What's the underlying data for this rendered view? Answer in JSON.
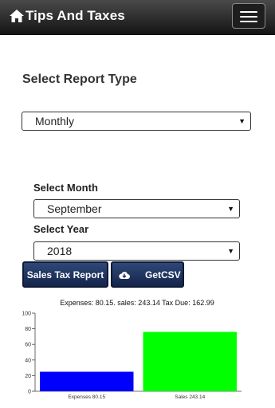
{
  "header": {
    "title": "Tips And Taxes",
    "menu_icon": "hamburger-menu-icon",
    "home_icon": "home-icon"
  },
  "report_type": {
    "label": "Select Report Type",
    "selected": "Monthly"
  },
  "month": {
    "label": "Select Month",
    "selected": "September"
  },
  "year": {
    "label": "Select Year",
    "selected": "2018"
  },
  "buttons": {
    "sales_tax_report": "Sales Tax Report",
    "get_csv": "GetCSV",
    "get_csv_icon": "cloud-download-icon"
  },
  "colors": {
    "button_bg": "#1e3263",
    "expenses_bar": "#0000ff",
    "sales_bar": "#00ff00"
  },
  "chart_data": {
    "type": "bar",
    "title": "Expenses: 80.15.  sales: 243.14  Tax Due: 162.99",
    "categories": [
      "Expenses 80.15",
      "Sales 243.14"
    ],
    "values": [
      25,
      76
    ],
    "colors": [
      "#0000ff",
      "#00ff00"
    ],
    "ylim": [
      0,
      100
    ],
    "yticks": [
      "0",
      "20",
      "40",
      "60",
      "80",
      "100"
    ],
    "grid": false
  }
}
